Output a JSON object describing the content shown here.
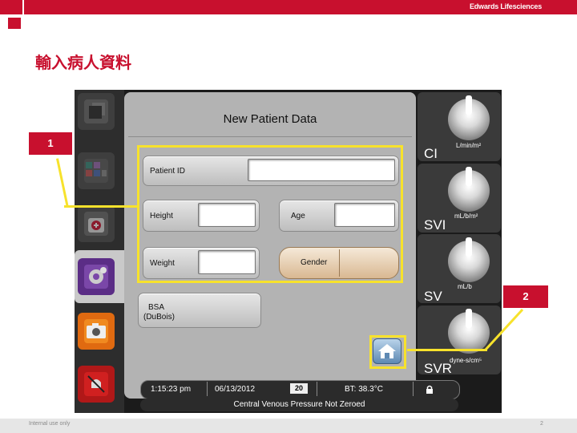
{
  "slide": {
    "brand": "Edwards Lifesciences",
    "title": "輸入病人資料",
    "footer": "Internal use only",
    "page_number": "2"
  },
  "panel": {
    "title": "New Patient Data",
    "fields": {
      "patient_id_label": "Patient ID",
      "height_label": "Height",
      "age_label": "Age",
      "weight_label": "Weight",
      "gender_label": "Gender",
      "bsa_label": "BSA",
      "bsa_formula": "(DuBois)"
    }
  },
  "status_bar": {
    "time": "1:15:23 pm",
    "date": "06/13/2012",
    "day": "20",
    "bt": "BT: 38.3°C",
    "lock_icon": "lock-icon",
    "message": "Central Venous Pressure Not Zeroed"
  },
  "params": [
    {
      "name": "CI",
      "unit": "L/min/m²"
    },
    {
      "name": "SVI",
      "unit": "mL/b/m²"
    },
    {
      "name": "SV",
      "unit": "mL/b"
    },
    {
      "name": "SVR",
      "unit": "dyne-s/cm⁵"
    }
  ],
  "callouts": {
    "one": "1",
    "two": "2"
  },
  "colors": {
    "brand_red": "#c8102e",
    "highlight_yellow": "#f7e22c"
  }
}
